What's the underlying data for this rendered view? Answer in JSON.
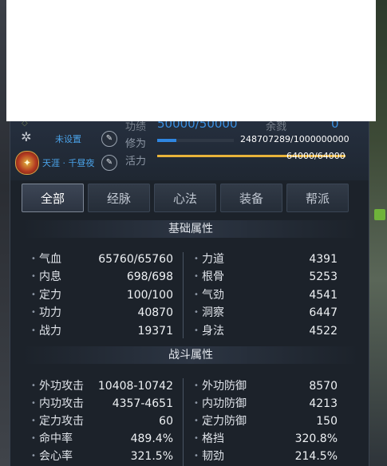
{
  "header": {
    "unset_label": "未设置",
    "title_label": "天涯 · 千昼夜",
    "gongji_label": "功绩",
    "gongji_value": "50000/50000",
    "yuxi_label": "余戮",
    "yuxi_value": "0",
    "xiuwei_label": "修为",
    "xiuwei_value": "248707289/1000000000",
    "xiuwei_progress": 0.2487,
    "huoli_label": "活力",
    "huoli_value": "64000/64000",
    "huoli_progress": 1.0
  },
  "tabs": [
    "全部",
    "经脉",
    "心法",
    "装备",
    "帮派"
  ],
  "active_tab": "全部",
  "basic": {
    "heading": "基础属性",
    "left": [
      {
        "label": "气血",
        "value": "65760/65760"
      },
      {
        "label": "内息",
        "value": "698/698"
      },
      {
        "label": "定力",
        "value": "100/100"
      },
      {
        "label": "功力",
        "value": "40870"
      },
      {
        "label": "战力",
        "value": "19371"
      }
    ],
    "right": [
      {
        "label": "力道",
        "value": "4391"
      },
      {
        "label": "根骨",
        "value": "5253"
      },
      {
        "label": "气劲",
        "value": "4541"
      },
      {
        "label": "洞察",
        "value": "6447"
      },
      {
        "label": "身法",
        "value": "4522"
      }
    ]
  },
  "combat": {
    "heading": "战斗属性",
    "left": [
      {
        "label": "外功攻击",
        "value": "10408-10742"
      },
      {
        "label": "内功攻击",
        "value": "4357-4651"
      },
      {
        "label": "定力攻击",
        "value": "60"
      },
      {
        "label": "命中率",
        "value": "489.4%"
      },
      {
        "label": "会心率",
        "value": "321.5%"
      }
    ],
    "right": [
      {
        "label": "外功防御",
        "value": "8570"
      },
      {
        "label": "内功防御",
        "value": "4213"
      },
      {
        "label": "定力防御",
        "value": "150"
      },
      {
        "label": "格挡",
        "value": "320.8%"
      },
      {
        "label": "韧劲",
        "value": "214.5%"
      }
    ]
  },
  "colors": {
    "accent": "#3a8fe0",
    "bar_gold": "#e8b33a",
    "panel_bg": "#1c222a"
  }
}
